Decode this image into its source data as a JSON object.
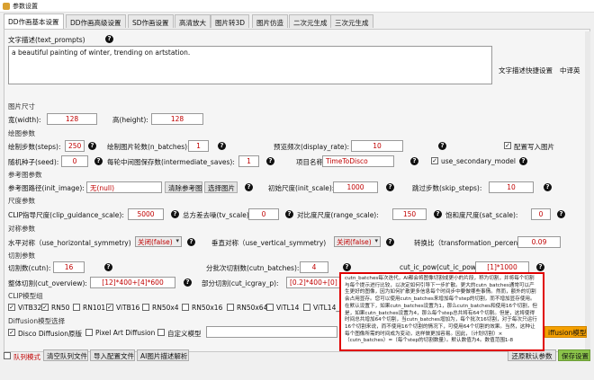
{
  "window": {
    "title": "参数设置"
  },
  "tabs": [
    {
      "label": "DD作画基本设置"
    },
    {
      "label": "DD作画高级设置"
    },
    {
      "label": "SD作画设置"
    },
    {
      "label": "高清放大"
    },
    {
      "label": "图片转3D"
    },
    {
      "label": "图片仿造"
    },
    {
      "label": "二次元生成"
    },
    {
      "label": "三次元生成"
    }
  ],
  "text_prompts": {
    "label": "文字描述(text_prompts)",
    "value": "a beautiful painting of winter, trending on artstation.",
    "quick_button": "文字描述快捷设置",
    "translate_button": "中译英"
  },
  "image_size": {
    "section": "图片尺寸",
    "width_label": "宽(width):",
    "width_value": "128",
    "height_label": "高(height):",
    "height_value": "128"
  },
  "draw_params": {
    "section": "绘图参数",
    "steps_label": "绘制步数(steps):",
    "steps_value": "250",
    "n_batches_label": "绘制图片轮数(n_batches):",
    "n_batches_value": "1",
    "display_rate_label": "预览频次(display_rate):",
    "display_rate_value": "10",
    "write_config_label": "配置写入图片",
    "seed_label": "随机种子(seed):",
    "seed_value": "0",
    "intermediate_label": "每轮中间图保存数(intermediate_saves):",
    "intermediate_value": "1",
    "project_label": "项目名称",
    "project_value": "TimeToDisco",
    "secondary_label": "use_secondary_model"
  },
  "ref_params": {
    "section": "参考图参数",
    "init_image_label": "参考图路径(init_image):",
    "init_image_value": "无(null)",
    "clear_button": "清除参考图",
    "choose_button": "选择图片",
    "init_scale_label": "初始尺度(init_scale):",
    "init_scale_value": "1000",
    "skip_label": "跳过步数(skip_steps):",
    "skip_value": "10"
  },
  "scale_params": {
    "section": "尺度参数",
    "clip_label": "CLIP指导尺度(clip_guidance_scale):",
    "clip_value": "5000",
    "tv_label": "总方差去噪(tv_scale):",
    "tv_value": "0",
    "range_label": "对比度尺度(range_scale):",
    "range_value": "150",
    "sat_label": "饱和度尺度(sat_scale):",
    "sat_value": "0"
  },
  "symmetry": {
    "section": "对称参数",
    "h_label": "水平对称（use_horizontal_symmetry)",
    "h_value": "关闭(false)",
    "v_label": "垂直对称（use_vertical_symmetry)",
    "v_value": "关闭(false)",
    "transform_label": "转换比（transformation_percent)",
    "transform_value": "0.09"
  },
  "cut": {
    "section": "切割参数",
    "cutn_label": "切割数(cutn):",
    "cutn_value": "16",
    "cutn_batches_label": "分批次切割数(cutn_batches):",
    "cutn_batches_value": "4",
    "cut_ic_pow_label": "cut_ic_pow(cut_ic_pow):",
    "cut_ic_pow_value": "[1]*1000",
    "overview_label": "整体切割(cut_overview):",
    "overview_value": "[12]*400+[4]*600",
    "icgray_label": "部分切割(cut_icgray_p):",
    "icgray_value": "[0.2]*400+[0]"
  },
  "clip_models": {
    "section": "CLIP模型组",
    "items": [
      {
        "label": "ViTB32",
        "checked": true
      },
      {
        "label": "RN50",
        "checked": true
      },
      {
        "label": "RN101",
        "checked": false
      },
      {
        "label": "ViTB16",
        "checked": true
      },
      {
        "label": "RN50x4",
        "checked": false
      },
      {
        "label": "RN50x16",
        "checked": false
      },
      {
        "label": "RN50x64",
        "checked": false
      },
      {
        "label": "ViTL14",
        "checked": false
      },
      {
        "label": "ViTL14_3",
        "checked": false
      }
    ]
  },
  "diffusion": {
    "section": "Diffusion模型选择",
    "opt1": "Disco Diffusion原版",
    "opt2": "Pixel Art Diffusion",
    "opt3": "自定义模型",
    "button": "iffusion模型"
  },
  "tooltip": {
    "text": "cutn_batches每次迭代，AI都会将图像切割成更小的片段，称为切割，并将每个切割与每个提示进行比较，以决定如何引导下一步扩散。更大的cutn_batches通常可以产生更好的图像，因为如何扩散更多信息每个时间步中要做哪些事情。然而，额外的切割会占用显存。您可以使用cutn_batches来增加每个step的切割，而不增加显存使用。在默认设置下，如果cutn_batches设置为1，那么cutn_batches和使用16个切割，但是，如果cutn_batches设置为4，那么每个step总共将有64个切割。但是，这将使得时间总共增加64个切割，当cutn_batches增加为，每个批次16切割，对于每次只运行16个切割来说，而不使用16个切割的情况下，可使用64个切割的效果。当然，这种让每个图像所需的时间成为变动，这样做更加容易。因此，（计划切割）×（cutn_batches）=（每个step的切割数量）。默认数值为4。数值范围1-8"
  },
  "footer": {
    "queue_label": "队列模式",
    "clear_queue": "清空队列文件",
    "import_config": "导入配置文件",
    "ai_parse": "AI图片描述解析",
    "restore_default": "还原默认参数",
    "save": "保存设置"
  },
  "colors": {
    "accent_red": "#c00000",
    "tooltip_border": "#e00000",
    "save_green": "#8bc34a",
    "orange": "#f5a000"
  }
}
